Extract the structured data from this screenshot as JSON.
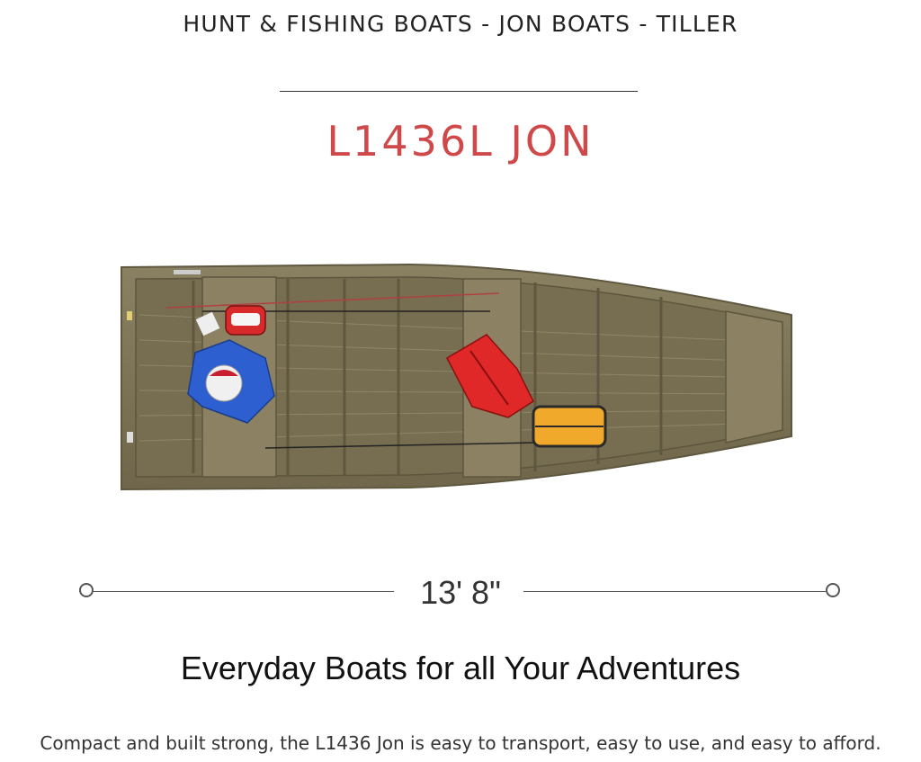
{
  "breadcrumb": "HUNT & FISHING BOATS - JON BOATS - TILLER",
  "model": {
    "name": "L1436L JON",
    "color": "#d0494a"
  },
  "boat": {
    "image_alt": "L1436L Jon boat top view",
    "hull_color": "#7e7457"
  },
  "dimension": {
    "length_label": "13' 8\""
  },
  "tagline": "Everyday Boats for all Your Adventures",
  "description": "Compact and built strong, the L1436 Jon is easy to transport, easy to use, and easy to afford."
}
